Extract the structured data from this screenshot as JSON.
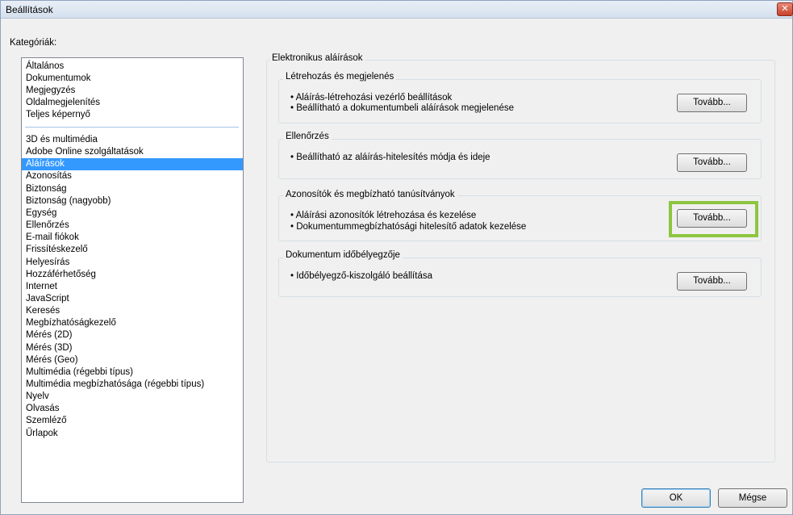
{
  "window": {
    "title": "Beállítások",
    "close_glyph": "✕"
  },
  "categories": {
    "label": "Kategóriák:",
    "group1": [
      "Általános",
      "Dokumentumok",
      "Megjegyzés",
      "Oldalmegjelenítés",
      "Teljes képernyő"
    ],
    "group2": [
      "3D és multimédia",
      "Adobe Online szolgáltatások",
      "Aláírások",
      "Azonosítás",
      "Biztonság",
      "Biztonság (nagyobb)",
      "Egység",
      "Ellenőrzés",
      "E-mail fiókok",
      "Frissítéskezelő",
      "Helyesírás",
      "Hozzáférhetőség",
      "Internet",
      "JavaScript",
      "Keresés",
      "Megbízhatóságkezelő",
      "Mérés (2D)",
      "Mérés (3D)",
      "Mérés (Geo)",
      "Multimédia (régebbi típus)",
      "Multimédia megbízhatósága (régebbi típus)",
      "Nyelv",
      "Olvasás",
      "Szemléző",
      "Űrlapok"
    ],
    "selected": "Aláírások"
  },
  "main": {
    "title": "Elektronikus aláírások",
    "sections": [
      {
        "title": "Létrehozás és megjelenés",
        "lines": [
          "• Aláírás-létrehozási vezérlő beállítások",
          "• Beállítható a dokumentumbeli aláírások megjelenése"
        ],
        "button": "Tovább..."
      },
      {
        "title": "Ellenőrzés",
        "lines": [
          "• Beállítható az aláírás-hitelesítés módja és ideje"
        ],
        "button": "Tovább..."
      },
      {
        "title": "Azonosítók és megbízható tanúsítványok",
        "lines": [
          "• Aláírási azonosítók létrehozása és kezelése",
          "• Dokumentummegbízhatósági hitelesítő adatok kezelése"
        ],
        "button": "Tovább..."
      },
      {
        "title": "Dokumentum időbélyegzője",
        "lines": [
          "• Időbélyegző-kiszolgáló beállítása"
        ],
        "button": "Tovább..."
      }
    ]
  },
  "footer": {
    "ok": "OK",
    "cancel": "Mégse"
  },
  "colors": {
    "selection": "#3399ff",
    "highlight": "#8dc63f"
  }
}
